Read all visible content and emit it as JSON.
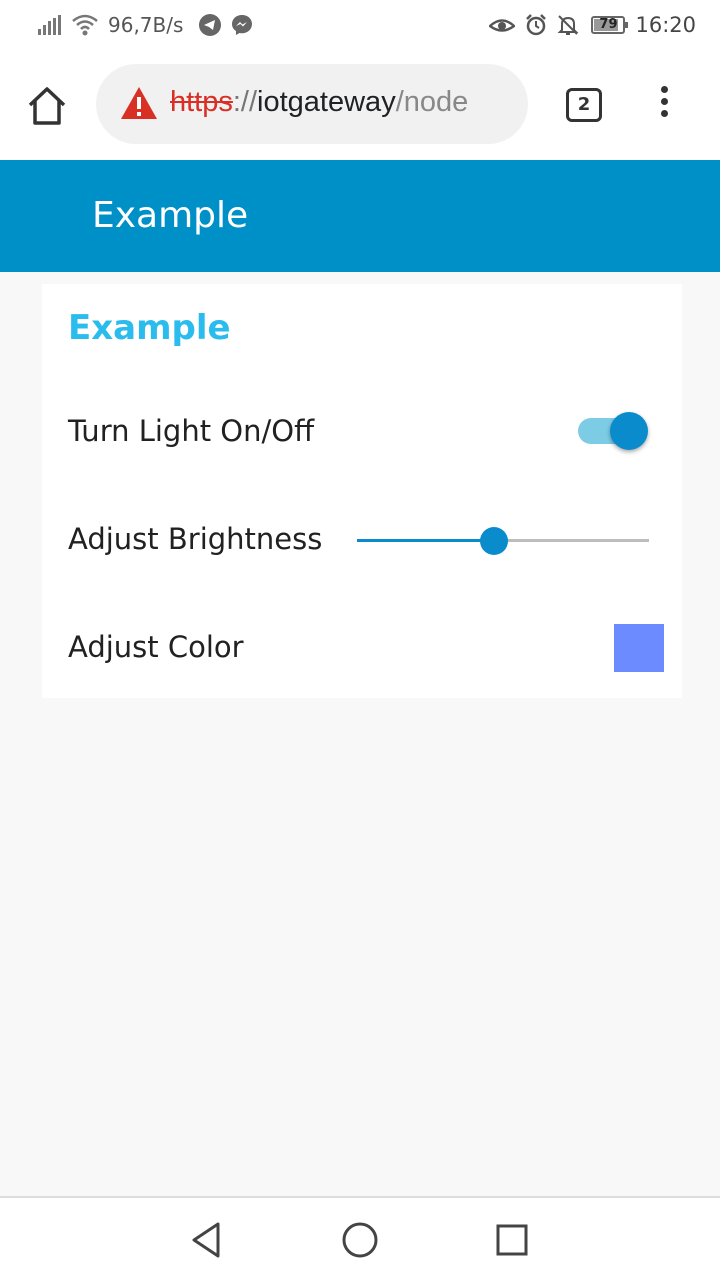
{
  "status_bar": {
    "network_speed": "96,7B/s",
    "battery": "79",
    "battery_level": 0.79,
    "time": "16:20",
    "icons_left": [
      "signal-icon",
      "wifi-icon",
      "telegram-icon",
      "messenger-icon"
    ],
    "icons_right": [
      "eye-icon",
      "alarm-icon",
      "notifications-off-icon",
      "battery-icon"
    ]
  },
  "browser": {
    "url_scheme": "https",
    "url_separator": "://",
    "url_host": "iotgateway",
    "url_path": "/node",
    "tab_count": "2",
    "security_warning_color": "#d93025"
  },
  "app": {
    "header_title": "Example",
    "header_color": "#0090c8"
  },
  "card": {
    "title": "Example",
    "title_color": "#2bbcee",
    "light_label": "Turn Light On/Off",
    "light_on": true,
    "brightness_label": "Adjust Brightness",
    "brightness_value": 0.47,
    "color_label": "Adjust Color",
    "color_value": "#6c8bff",
    "accent_color": "#0a8ccc"
  },
  "nav": {
    "buttons": [
      "back-icon",
      "home-circle-icon",
      "recents-icon"
    ]
  }
}
